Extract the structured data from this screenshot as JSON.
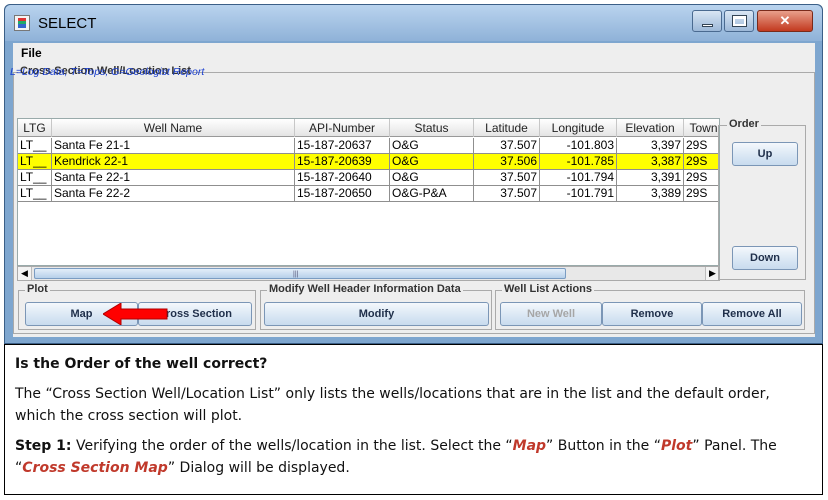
{
  "window": {
    "title": "SELECT"
  },
  "menu": {
    "file": "File"
  },
  "panel": {
    "title": "Cross Section Well/Location List",
    "legend_note": "L=Log Data, T=Tops, G=Geologist Report"
  },
  "table": {
    "columns": [
      "LTG",
      "Well Name",
      "API-Number",
      "Status",
      "Latitude",
      "Longitude",
      "Elevation",
      "Town"
    ],
    "rows": [
      {
        "ltg": "LT__",
        "name": "Santa Fe 21-1",
        "api": "15-187-20637",
        "status": "O&G",
        "lat": "37.507",
        "lon": "-101.803",
        "elev": "3,397",
        "town": "29S"
      },
      {
        "ltg": "LT__",
        "name": "Kendrick 22-1",
        "api": "15-187-20639",
        "status": "O&G",
        "lat": "37.506",
        "lon": "-101.785",
        "elev": "3,387",
        "town": "29S"
      },
      {
        "ltg": "LT__",
        "name": "Santa Fe 22-1",
        "api": "15-187-20640",
        "status": "O&G",
        "lat": "37.507",
        "lon": "-101.794",
        "elev": "3,391",
        "town": "29S"
      },
      {
        "ltg": "LT__",
        "name": "Santa Fe 22-2",
        "api": "15-187-20650",
        "status": "O&G-P&A",
        "lat": "37.507",
        "lon": "-101.791",
        "elev": "3,389",
        "town": "29S"
      }
    ],
    "selected_row": 1,
    "selected_color": "#ffff00"
  },
  "order": {
    "title": "Order",
    "up": "Up",
    "down": "Down"
  },
  "plot": {
    "title": "Plot",
    "map": "Map",
    "cross_section": "Cross Section"
  },
  "modify": {
    "title": "Modify Well Header Information Data",
    "modify": "Modify"
  },
  "actions": {
    "title": "Well List Actions",
    "new_well": "New Well",
    "remove": "Remove",
    "remove_all": "Remove All"
  },
  "annotation": {
    "question": "Is the Order of the well correct?",
    "para1": "The “Cross Section Well/Location List” only lists the wells/locations that are in the list and the default order, which the cross section will plot.",
    "step_label": "Step 1:",
    "step_text_1": " Verifying the order of the wells/location in the list.  Select the “",
    "step_hl_map": "Map",
    "step_text_2": "” Button in the “",
    "step_hl_plot": "Plot",
    "step_text_3": "” Panel.  The “",
    "step_hl_dialog": "Cross Section Map",
    "step_text_4": "” Dialog will be displayed.",
    "highlight_color": "#c0392b"
  },
  "icons": {
    "app": "app-icon",
    "minimize": "minimize-icon",
    "maximize": "maximize-icon",
    "close": "close-icon",
    "pointer": "red-arrow-icon"
  }
}
